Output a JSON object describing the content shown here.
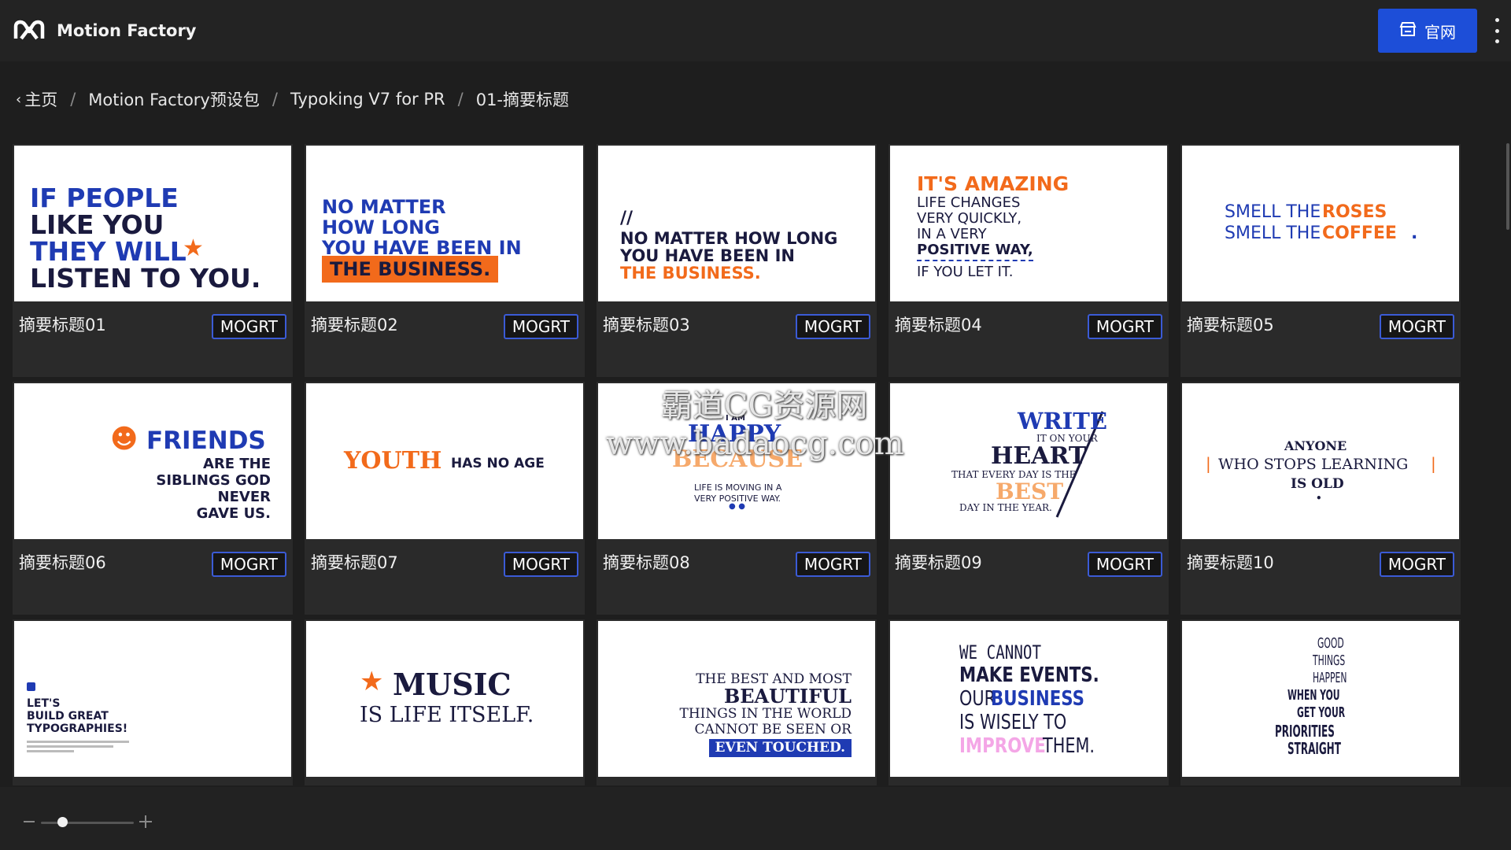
{
  "app": {
    "title": "Motion Factory",
    "site_button_label": "官网",
    "logo_icon": "motion-factory-logo-icon"
  },
  "breadcrumb": {
    "items": [
      "主页",
      "Motion Factory预设包",
      "Typoking V7 for PR",
      "01-摘要标题"
    ],
    "separator": "/"
  },
  "cards": [
    {
      "title": "摘要标题01",
      "badge": "MOGRT",
      "preview": [
        "IF PEOPLE",
        "LIKE YOU",
        "THEY WILL",
        "LISTEN TO YOU."
      ]
    },
    {
      "title": "摘要标题02",
      "badge": "MOGRT",
      "preview": [
        "NO MATTER",
        "HOW LONG",
        "YOU HAVE BEEN IN",
        "THE BUSINESS."
      ]
    },
    {
      "title": "摘要标题03",
      "badge": "MOGRT",
      "preview": [
        "//",
        "NO MATTER HOW LONG",
        "YOU HAVE BEEN IN",
        "THE BUSINESS."
      ]
    },
    {
      "title": "摘要标题04",
      "badge": "MOGRT",
      "preview": [
        "IT'S AMAZING",
        "LIFE CHANGES",
        "VERY QUICKLY,",
        "IN A VERY",
        "POSITIVE WAY,",
        "IF YOU LET IT."
      ]
    },
    {
      "title": "摘要标题05",
      "badge": "MOGRT",
      "preview": [
        "SMELL THE",
        "ROSES",
        "SMELL THE",
        "COFFEE",
        "."
      ]
    },
    {
      "title": "摘要标题06",
      "badge": "MOGRT",
      "preview": [
        "FRIENDS",
        "ARE THE",
        "SIBLINGS GOD",
        "NEVER",
        "GAVE US."
      ]
    },
    {
      "title": "摘要标题07",
      "badge": "MOGRT",
      "preview": [
        "YOUTH",
        "HAS NO AGE"
      ]
    },
    {
      "title": "摘要标题08",
      "badge": "MOGRT",
      "preview": [
        "I AM",
        "HAPPY",
        "BECAUSE",
        "LIFE IS MOVING IN A",
        "VERY POSITIVE WAY."
      ]
    },
    {
      "title": "摘要标题09",
      "badge": "MOGRT",
      "preview": [
        "WRITE",
        "IT ON YOUR",
        "HEART",
        "THAT EVERY DAY IS THE",
        "BEST",
        "DAY IN THE YEAR."
      ]
    },
    {
      "title": "摘要标题10",
      "badge": "MOGRT",
      "preview": [
        "ANYONE",
        "WHO STOPS LEARNING",
        "IS OLD"
      ]
    },
    {
      "title": "",
      "badge": "",
      "preview": [
        "LET'S",
        "BUILD GREAT",
        "TYPOGRAPHIES!"
      ]
    },
    {
      "title": "",
      "badge": "",
      "preview": [
        "MUSIC",
        "IS LIFE ITSELF."
      ]
    },
    {
      "title": "",
      "badge": "",
      "preview": [
        "THE BEST AND MOST",
        "BEAUTIFUL",
        "THINGS IN THE WORLD",
        "CANNOT BE SEEN OR",
        "EVEN TOUCHED."
      ]
    },
    {
      "title": "",
      "badge": "",
      "preview": [
        "WE CANNOT",
        "MAKE EVENTS.",
        "OUR",
        "BUSINESS",
        "IS WISELY TO",
        "IMPROVE",
        "THEM."
      ]
    },
    {
      "title": "",
      "badge": "",
      "preview": [
        "GOOD",
        "THINGS",
        "HAPPEN",
        "WHEN YOU",
        "GET YOUR",
        "PRIORITIES",
        "STRAIGHT"
      ]
    }
  ],
  "watermark": [
    "霸道CG资源网",
    "www.badaocg.com"
  ],
  "zoom": {
    "level": 0.2
  },
  "colors": {
    "accent": "#1d4ed8",
    "badge_border": "#3b5bd6",
    "preview_blue": "#1f3bb3",
    "preview_orange": "#f26a1b"
  }
}
